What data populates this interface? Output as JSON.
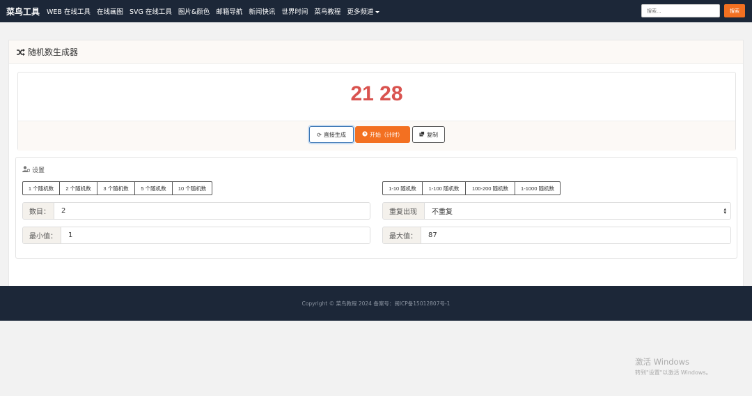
{
  "nav": {
    "brand": "菜鸟工具",
    "links": [
      "WEB 在线工具",
      "在线画图",
      "SVG 在线工具",
      "图片&颜色",
      "邮箱导航",
      "新闻快讯",
      "世界时间",
      "菜鸟教程",
      "更多频道"
    ],
    "search_placeholder": "搜索...",
    "search_button": "搜索"
  },
  "panel": {
    "title": "随机数生成器"
  },
  "result": {
    "numbers": "21 28"
  },
  "actions": {
    "direct": "直接生成",
    "start": "开始（计时）",
    "copy": "复制"
  },
  "settings": {
    "title": "设置",
    "count_presets": [
      "1 个随机数",
      "2 个随机数",
      "3 个随机数",
      "5 个随机数",
      "10 个随机数"
    ],
    "range_presets": [
      "1-10 随机数",
      "1-100 随机数",
      "100-200 随机数",
      "1-1000 随机数"
    ],
    "count_label": "数目：",
    "count_value": "2",
    "repeat_label": "重复出现",
    "repeat_value": "不重复",
    "min_label": "最小值：",
    "min_value": "1",
    "max_label": "最大值：",
    "max_value": "87"
  },
  "footer": {
    "text": "Copyright © 菜鸟教程 2024 备案号：闽ICP备15012807号-1"
  },
  "watermark": {
    "line1": "激活 Windows",
    "line2": "转到\"设置\"以激活 Windows。"
  },
  "colors": {
    "nav_bg": "#1c2738",
    "accent": "#f37021",
    "result_red": "#d9534f"
  }
}
